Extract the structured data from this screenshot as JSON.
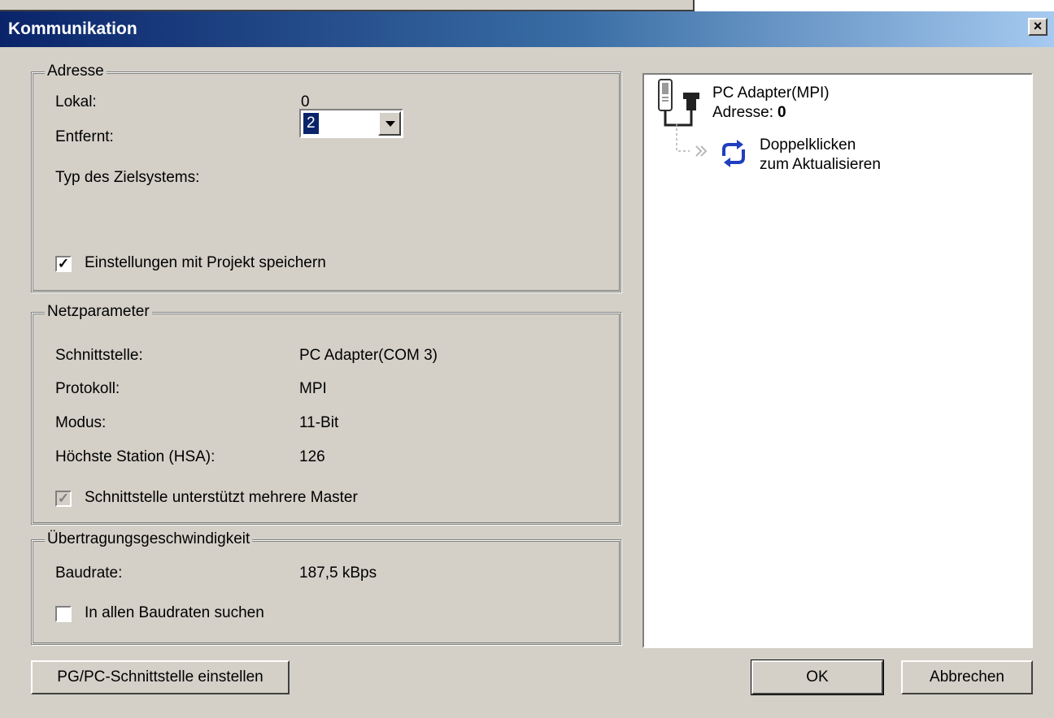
{
  "window": {
    "title": "Kommunikation",
    "close_label": "×"
  },
  "adresse": {
    "legend": "Adresse",
    "lokal_label": "Lokal:",
    "lokal_value": "0",
    "entfernt_label": "Entfernt:",
    "entfernt_value": "2",
    "typ_label": "Typ des Zielsystems:",
    "save_checkbox_label": "Einstellungen mit Projekt speichern",
    "save_checked": true
  },
  "netz": {
    "legend": "Netzparameter",
    "rows": [
      {
        "label": "Schnittstelle:",
        "value": "PC Adapter(COM 3)"
      },
      {
        "label": "Protokoll:",
        "value": "MPI"
      },
      {
        "label": "Modus:",
        "value": "11-Bit"
      },
      {
        "label": "Höchste Station (HSA):",
        "value": "126"
      }
    ],
    "multi_master_label": "Schnittstelle unterstützt mehrere Master",
    "multi_master_checked": true,
    "multi_master_disabled": true
  },
  "speed": {
    "legend": "Übertragungsgeschwindigkeit",
    "baud_label": "Baudrate:",
    "baud_value": "187,5 kBps",
    "search_label": "In allen Baudraten suchen",
    "search_checked": false
  },
  "tree": {
    "adapter_name": "PC Adapter(MPI)",
    "adapter_addr_label": "Adresse:",
    "adapter_addr_value": "0",
    "refresh_line1": "Doppelklicken",
    "refresh_line2": "zum Aktualisieren"
  },
  "buttons": {
    "pgpc": "PG/PC-Schnittstelle einstellen",
    "ok": "OK",
    "cancel": "Abbrechen"
  },
  "colors": {
    "title_start": "#0a246a",
    "title_end": "#a6caf0",
    "face": "#d4d0c8",
    "selection": "#0a246a",
    "refresh_icon": "#1f3fbf"
  }
}
